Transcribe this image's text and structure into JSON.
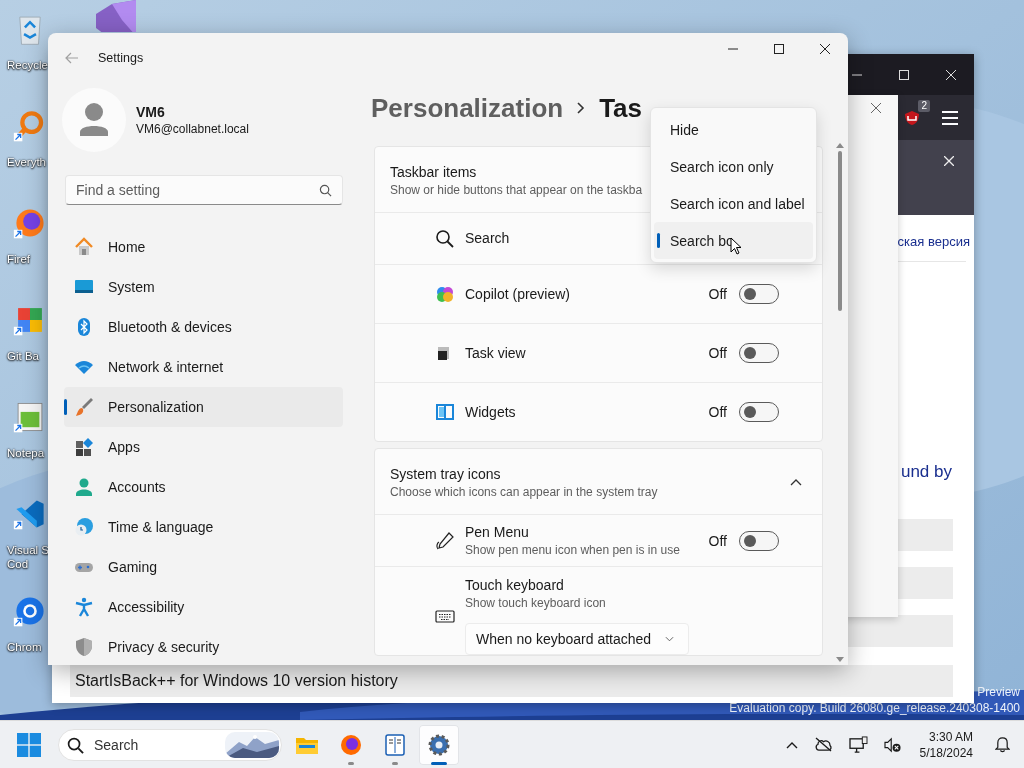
{
  "desktop_icons": [
    {
      "lines": [
        "Recycle"
      ]
    },
    {
      "lines": [
        "Everyth"
      ]
    },
    {
      "lines": [
        "Firef"
      ]
    },
    {
      "lines": [
        "Git Ba"
      ]
    },
    {
      "lines": [
        "Notepa"
      ]
    },
    {
      "lines": [
        "Visual S",
        "Cod"
      ]
    },
    {
      "lines": [
        "Chrom"
      ]
    }
  ],
  "watermark": {
    "edition": "Preview",
    "build": "Evaluation copy. Build 26080.ge_release.240308-1400"
  },
  "browser": {
    "badge": "2",
    "link": "ская версия",
    "heading": "und by",
    "row_text": "StartIsBack++ for Windows 10 version history"
  },
  "settings": {
    "title": "Settings",
    "user": {
      "name": "VM6",
      "email": "VM6@collabnet.local"
    },
    "search": {
      "placeholder": "Find a setting"
    },
    "nav": [
      {
        "label": "Home",
        "selected": false
      },
      {
        "label": "System",
        "selected": false
      },
      {
        "label": "Bluetooth & devices",
        "selected": false
      },
      {
        "label": "Network & internet",
        "selected": false
      },
      {
        "label": "Personalization",
        "selected": true
      },
      {
        "label": "Apps",
        "selected": false
      },
      {
        "label": "Accounts",
        "selected": false
      },
      {
        "label": "Time & language",
        "selected": false
      },
      {
        "label": "Gaming",
        "selected": false
      },
      {
        "label": "Accessibility",
        "selected": false
      },
      {
        "label": "Privacy & security",
        "selected": false
      }
    ],
    "breadcrumb": [
      "Personalization",
      "Tas"
    ],
    "sections": [
      {
        "title": "Taskbar items",
        "subtitle": "Show or hide buttons that appear on the taskba",
        "items": [
          {
            "kind": "menu",
            "label": "Search"
          },
          {
            "kind": "toggle",
            "label": "Copilot (preview)",
            "state_text": "Off",
            "on": false
          },
          {
            "kind": "toggle",
            "label": "Task view",
            "state_text": "Off",
            "on": false
          },
          {
            "kind": "toggle",
            "label": "Widgets",
            "state_text": "Off",
            "on": false
          }
        ]
      },
      {
        "title": "System tray icons",
        "subtitle": "Choose which icons can appear in the system tray",
        "expanded": true,
        "items": [
          {
            "kind": "toggle",
            "label": "Pen Menu",
            "description": "Show pen menu icon when pen is in use",
            "state_text": "Off",
            "on": false
          },
          {
            "kind": "dropdown",
            "label": "Touch keyboard",
            "description": "Show touch keyboard icon",
            "value": "When no keyboard attached"
          }
        ]
      }
    ],
    "menu": {
      "items": [
        {
          "label": "Hide",
          "selected": false
        },
        {
          "label": "Search icon only",
          "selected": false
        },
        {
          "label": "Search icon and label",
          "selected": false
        },
        {
          "label": "Search bo",
          "selected": true
        }
      ]
    }
  },
  "taskbar": {
    "search": {
      "placeholder": "Search"
    },
    "apps": [
      {
        "running": false,
        "selected": false
      },
      {
        "running": true,
        "selected": false
      },
      {
        "running": true,
        "selected": false
      },
      {
        "running": true,
        "selected": true
      }
    ],
    "time": "3:30 AM",
    "date": "5/18/2024"
  }
}
